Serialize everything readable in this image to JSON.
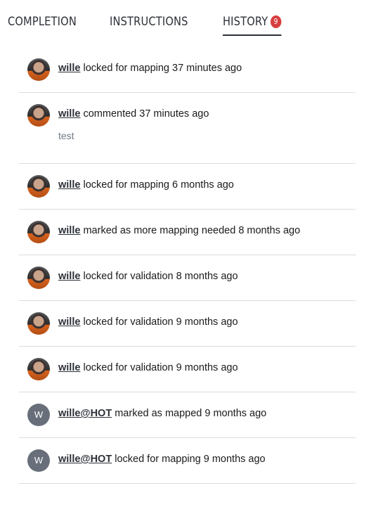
{
  "tabs": [
    {
      "label": "COMPLETION"
    },
    {
      "label": "INSTRUCTIONS"
    },
    {
      "label": "HISTORY",
      "badge": "9"
    }
  ],
  "history": [
    {
      "user": "wille",
      "action": "locked for mapping 37 minutes ago",
      "avatar": "photo"
    },
    {
      "user": "wille",
      "action": "commented 37 minutes ago",
      "comment": "test",
      "avatar": "photo"
    },
    {
      "user": "wille",
      "action": "locked for mapping 6 months ago",
      "avatar": "photo"
    },
    {
      "user": "wille",
      "action": "marked as more mapping needed 8 months ago",
      "avatar": "photo"
    },
    {
      "user": "wille",
      "action": "locked for validation 8 months ago",
      "avatar": "photo"
    },
    {
      "user": "wille",
      "action": "locked for validation 9 months ago",
      "avatar": "photo"
    },
    {
      "user": "wille",
      "action": "locked for validation 9 months ago",
      "avatar": "photo"
    },
    {
      "user": "wille@HOT",
      "action": "marked as mapped 9 months ago",
      "avatar": "W"
    },
    {
      "user": "wille@HOT",
      "action": "locked for mapping 9 months ago",
      "avatar": "W"
    }
  ]
}
